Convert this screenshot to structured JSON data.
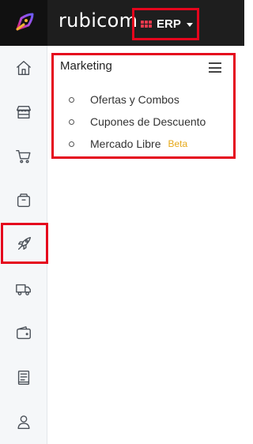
{
  "header": {
    "brand": "rubicom",
    "app_switcher_label": "ERP"
  },
  "sidebar": {
    "items": [
      {
        "icon": "home-icon",
        "id": "home"
      },
      {
        "icon": "store-icon",
        "id": "store"
      },
      {
        "icon": "cart-icon",
        "id": "cart"
      },
      {
        "icon": "package-icon",
        "id": "products"
      },
      {
        "icon": "rocket-icon",
        "id": "marketing",
        "active": true
      },
      {
        "icon": "truck-icon",
        "id": "shipping"
      },
      {
        "icon": "wallet-icon",
        "id": "wallet"
      },
      {
        "icon": "book-icon",
        "id": "catalog"
      },
      {
        "icon": "user-icon",
        "id": "users"
      }
    ]
  },
  "panel": {
    "title": "Marketing",
    "items": [
      {
        "label": "Ofertas y Combos"
      },
      {
        "label": "Cupones de Descuento"
      },
      {
        "label": "Mercado Libre",
        "badge": "Beta"
      }
    ]
  },
  "colors": {
    "topbar": "#1e1e1e",
    "highlight": "#e5061d",
    "badge": "#e6a817"
  }
}
